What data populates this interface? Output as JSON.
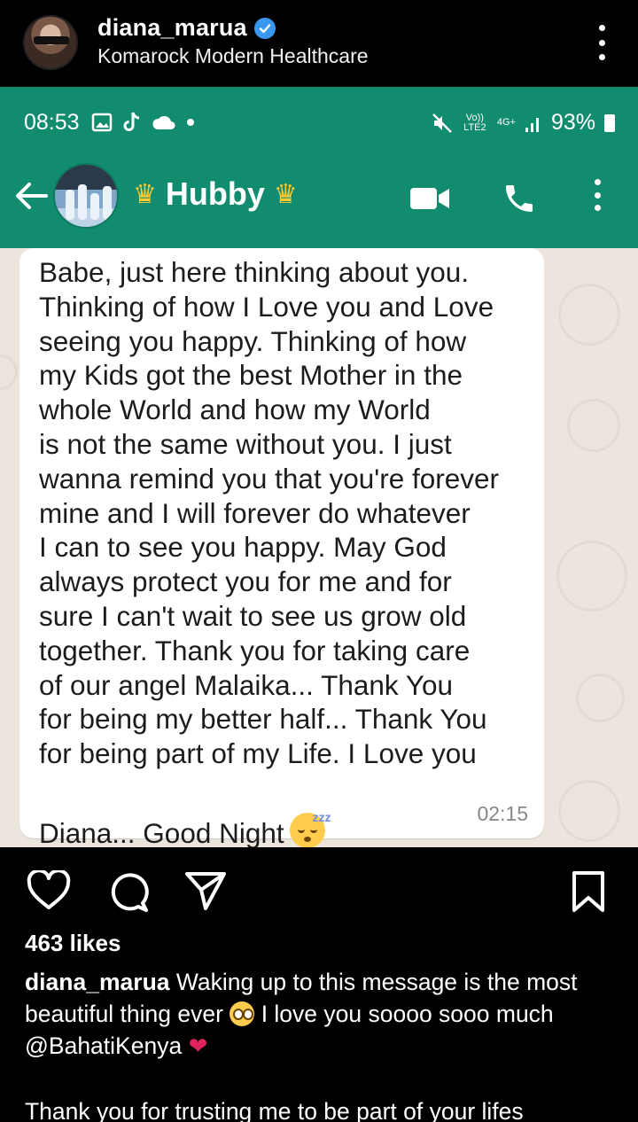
{
  "instagram": {
    "username": "diana_marua",
    "location": "Komarock Modern Healthcare",
    "verified_icon": "verified-badge-icon",
    "likes": "463 likes",
    "caption_username": "diana_marua",
    "caption_text_1": "Waking up to this message is the most beautiful thing ever",
    "caption_text_2": "I love you soooo sooo much",
    "caption_mention": "@BahatiKenya",
    "caption_text_3": "Thank you for trusting me to be part of your lifes"
  },
  "status_bar": {
    "time": "08:53",
    "volte": "Vo)) LTE2",
    "network": "4G+",
    "battery": "93%"
  },
  "chat": {
    "contact_name": "Hubby",
    "message": "Babe, just here thinking about you.\nThinking of how I Love you and Love\nseeing you happy. Thinking of how\nmy Kids got the best Mother in the\nwhole World and how my World\nis not the same without you. I just\nwanna remind you that you're forever\nmine and I will forever do whatever\nI can to see you happy. May God\nalways protect you for me and for\nsure I can't wait to see us grow old\ntogether. Thank you for taking care\nof our angel Malaika... Thank You\nfor being my better half... Thank You\nfor being part of my Life. I Love you",
    "message_last_line": "Diana... Good Night",
    "message_time": "02:15"
  },
  "colors": {
    "whatsapp_green": "#128c6e",
    "chat_wallpaper": "#ece5dd",
    "instagram_bg": "#000000",
    "verified_blue": "#3897f0",
    "heart_red": "#e0245e"
  }
}
